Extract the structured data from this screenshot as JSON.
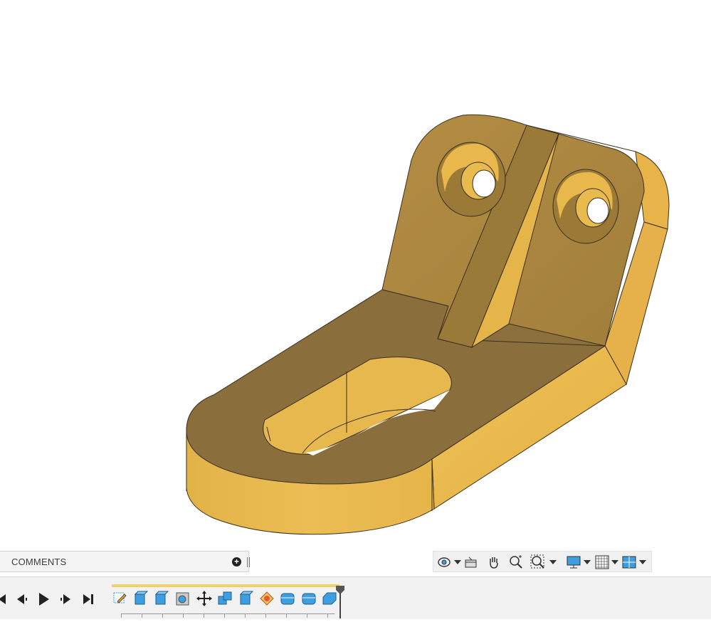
{
  "comments_panel": {
    "label": "COMMENTS",
    "add_icon": "plus-circle-icon"
  },
  "nav_toolbar": {
    "tools": [
      {
        "icon": "orbit-icon",
        "has_menu": true
      },
      {
        "icon": "look-at-icon",
        "has_menu": false
      },
      {
        "icon": "pan-hand-icon",
        "has_menu": false
      },
      {
        "icon": "zoom-icon",
        "has_menu": false
      },
      {
        "icon": "fit-window-icon",
        "has_menu": true
      },
      {
        "icon": "display-settings-icon",
        "has_menu": true
      },
      {
        "icon": "grid-snaps-icon",
        "has_menu": true
      },
      {
        "icon": "viewports-icon",
        "has_menu": true
      }
    ]
  },
  "timeline": {
    "controls": [
      "go-to-start-icon",
      "step-back-icon",
      "play-icon",
      "step-forward-icon",
      "go-to-end-icon"
    ],
    "features": [
      "sketch-feature-icon",
      "extrude-feature-icon",
      "extrude-feature-icon",
      "hole-feature-icon",
      "move-feature-icon",
      "combine-feature-icon",
      "extrude-feature-icon",
      "rib-feature-icon",
      "fillet-feature-icon",
      "fillet-feature-icon",
      "chamfer-feature-icon"
    ]
  },
  "colors": {
    "part_base": "#e6b54a",
    "part_top": "#8b703d",
    "part_upright": "#a8843f",
    "timeline_track": "#f4d166",
    "feature_blue": "#3e9fe0"
  }
}
